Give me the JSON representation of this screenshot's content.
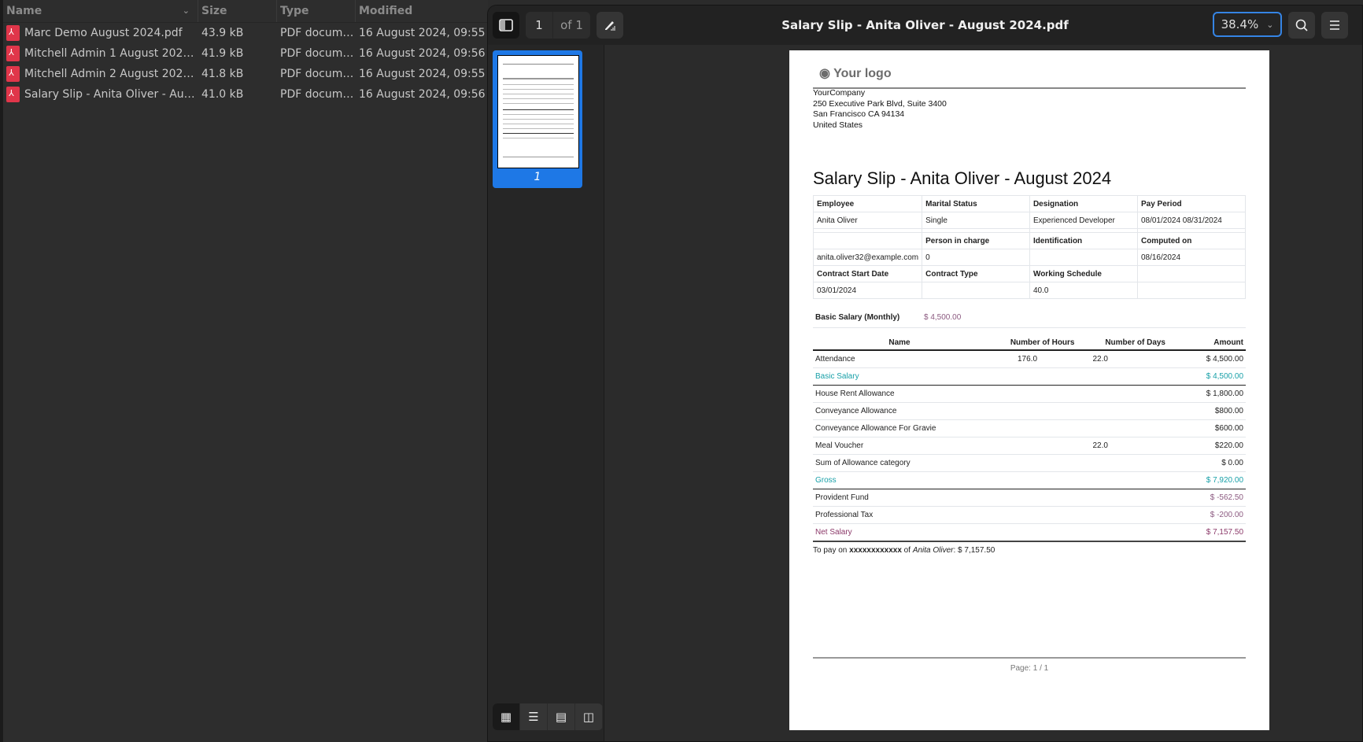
{
  "file_list": {
    "columns": {
      "name": "Name",
      "size": "Size",
      "type": "Type",
      "modified": "Modified"
    },
    "rows": [
      {
        "name": "Marc Demo August 2024.pdf",
        "size": "43.9 kB",
        "type": "PDF docum…",
        "modified": "16 August 2024, 09:55"
      },
      {
        "name": "Mitchell Admin 1 August 2024.…",
        "size": "41.9 kB",
        "type": "PDF docum…",
        "modified": "16 August 2024, 09:56"
      },
      {
        "name": "Mitchell Admin 2 August 2024.…",
        "size": "41.8 kB",
        "type": "PDF docum…",
        "modified": "16 August 2024, 09:55"
      },
      {
        "name": "Salary Slip - Anita Oliver - Augu…",
        "size": "41.0 kB",
        "type": "PDF docum…",
        "modified": "16 August 2024, 09:56"
      }
    ]
  },
  "viewer": {
    "title": "Salary Slip - Anita Oliver - August 2024.pdf",
    "page_current": "1",
    "page_total_label": "of 1",
    "zoom": "38.4%",
    "thumbnail_label": "1",
    "accent": "#3584e4"
  },
  "document": {
    "logo": "Your logo",
    "company": [
      "YourCompany",
      "250 Executive Park Blvd, Suite 3400",
      "San Francisco CA 94134",
      "United States"
    ],
    "title": "Salary Slip - Anita Oliver - August 2024",
    "info": {
      "r1": [
        "Employee",
        "Marital Status",
        "Designation",
        "Pay Period"
      ],
      "r2": [
        "Anita Oliver",
        "Single",
        "Experienced Developer",
        "08/01/2024 08/31/2024"
      ],
      "r3": [
        "",
        "Person in charge",
        "Identification",
        "Computed on"
      ],
      "r4": [
        "anita.oliver32@example.com",
        "0",
        "",
        "08/16/2024"
      ],
      "r5": [
        "Contract Start Date",
        "Contract Type",
        "Working Schedule",
        ""
      ],
      "r6": [
        "03/01/2024",
        "",
        "40.0",
        ""
      ]
    },
    "basic_salary_label": "Basic Salary (Monthly)",
    "basic_salary_value": "$ 4,500.00",
    "lines_header": [
      "Name",
      "Number of Hours",
      "Number of Days",
      "Amount"
    ],
    "lines": [
      {
        "name": "Attendance",
        "hours": "176.0",
        "days": "22.0",
        "amount": "$ 4,500.00"
      },
      {
        "name": "Basic Salary",
        "hours": "",
        "days": "",
        "amount": "$ 4,500.00"
      },
      {
        "name": "House Rent Allowance",
        "hours": "",
        "days": "",
        "amount": "$ 1,800.00"
      },
      {
        "name": "Conveyance Allowance",
        "hours": "",
        "days": "",
        "amount": "$800.00"
      },
      {
        "name": "Conveyance Allowance For Gravie",
        "hours": "",
        "days": "",
        "amount": "$600.00"
      },
      {
        "name": "Meal Voucher",
        "hours": "",
        "days": "22.0",
        "amount": "$220.00"
      },
      {
        "name": "Sum of Allowance category",
        "hours": "",
        "days": "",
        "amount": "$ 0.00"
      },
      {
        "name": "Gross",
        "hours": "",
        "days": "",
        "amount": "$ 7,920.00"
      },
      {
        "name": "Provident Fund",
        "hours": "",
        "days": "",
        "amount": "$ -562.50"
      },
      {
        "name": "Professional Tax",
        "hours": "",
        "days": "",
        "amount": "$ -200.00"
      },
      {
        "name": "Net Salary",
        "hours": "",
        "days": "",
        "amount": "$ 7,157.50"
      }
    ],
    "to_pay": {
      "prefix": "To pay on ",
      "account": "xxxxxxxxxxxx",
      "of": " of ",
      "employee": "Anita Oliver",
      "amount": ": $ 7,157.50"
    },
    "footer": "Page: 1 / 1",
    "colors": {
      "teal": "#18a0a8",
      "plum": "#8c5a80"
    }
  }
}
